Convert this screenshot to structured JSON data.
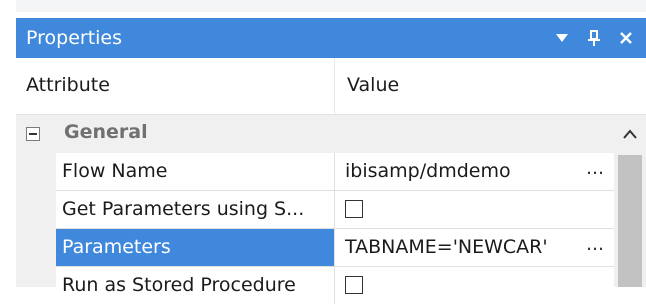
{
  "panel": {
    "title": "Properties",
    "controls": [
      {
        "name": "dropdown-arrow-icon",
        "glyph": "▼"
      },
      {
        "name": "pin-icon",
        "glyph": "ᵻ"
      },
      {
        "name": "close-icon",
        "glyph": "✕"
      }
    ]
  },
  "columns": {
    "attribute": "Attribute",
    "value": "Value"
  },
  "group": {
    "label": "General",
    "expanded": true
  },
  "rows": [
    {
      "name": "Flow Name",
      "value": "ibisamp/dmdemo",
      "type": "text",
      "has_more": true,
      "selected": false
    },
    {
      "name": "Get Parameters using S...",
      "value": "",
      "type": "checkbox",
      "checked": false,
      "has_more": false,
      "selected": false
    },
    {
      "name": "Parameters",
      "value": "TABNAME='NEWCAR'",
      "type": "text",
      "has_more": true,
      "selected": true
    },
    {
      "name": "Run as Stored Procedure",
      "value": "",
      "type": "checkbox",
      "checked": false,
      "has_more": false,
      "selected": false
    }
  ],
  "more_label": "...",
  "colors": {
    "titlebar": "#3f88db",
    "selection": "#3f88db",
    "gutter": "#f0f0f0",
    "scroll_thumb": "#c2c2c2"
  }
}
